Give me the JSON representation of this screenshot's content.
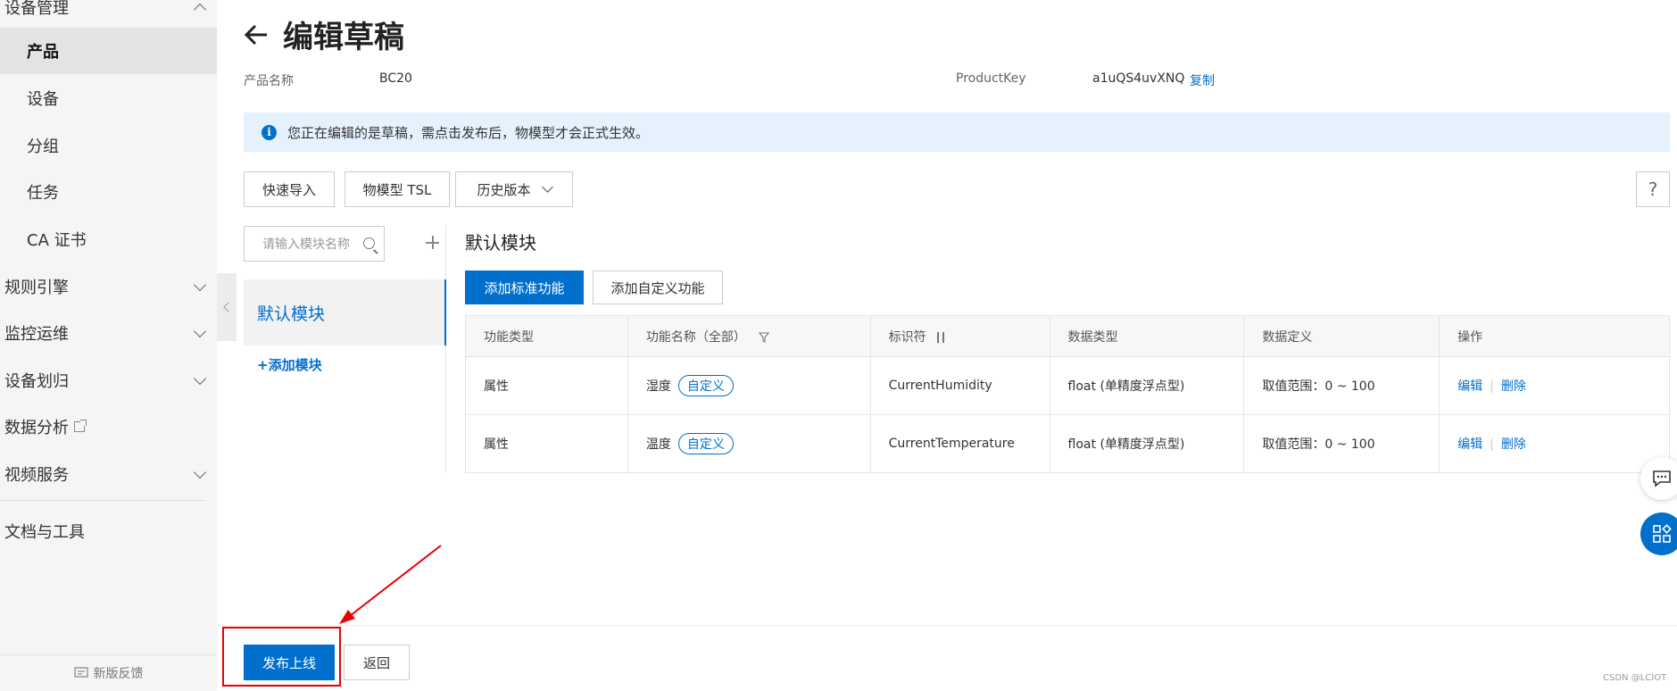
{
  "sidebar": {
    "group_title": "设备管理",
    "sub_items": [
      "产品",
      "设备",
      "分组",
      "任务",
      "CA 证书"
    ],
    "top_items": [
      "规则引擎",
      "监控运维",
      "设备划归",
      "数据分析",
      "视频服务"
    ],
    "docs": "文档与工具",
    "feedback": "新版反馈"
  },
  "page": {
    "title": "编辑草稿",
    "product_name_label": "产品名称",
    "product_name_value": "BC20",
    "product_key_label": "ProductKey",
    "product_key_value": "a1uQS4uvXNQ",
    "copy_link": "复制",
    "banner_text": "您正在编辑的是草稿，需点击发布后，物模型才会正式生效。"
  },
  "toolbar": {
    "quick_import": "快速导入",
    "tsl": "物模型 TSL",
    "history": "历史版本",
    "help": "?"
  },
  "modules": {
    "search_placeholder": "请输入模块名称",
    "default_module": "默认模块",
    "add_module": "+添加模块"
  },
  "section": {
    "title": "默认模块",
    "add_standard": "添加标准功能",
    "add_custom": "添加自定义功能"
  },
  "table": {
    "headers": [
      "功能类型",
      "功能名称（全部）",
      "标识符",
      "数据类型",
      "数据定义",
      "操作"
    ],
    "rows": [
      {
        "type": "属性",
        "name": "湿度",
        "tag": "自定义",
        "identifier": "CurrentHumidity",
        "data_type": "float (单精度浮点型)",
        "definition": "取值范围：0 ~ 100",
        "edit": "编辑",
        "delete": "删除"
      },
      {
        "type": "属性",
        "name": "温度",
        "tag": "自定义",
        "identifier": "CurrentTemperature",
        "data_type": "float (单精度浮点型)",
        "definition": "取值范围：0 ~ 100",
        "edit": "编辑",
        "delete": "删除"
      }
    ]
  },
  "footer": {
    "publish": "发布上线",
    "back": "返回"
  },
  "watermark": "CSDN @LCIOT",
  "colors": {
    "primary": "#0070cc",
    "highlight": "#e60000",
    "banner_bg": "#e5f2fd"
  }
}
